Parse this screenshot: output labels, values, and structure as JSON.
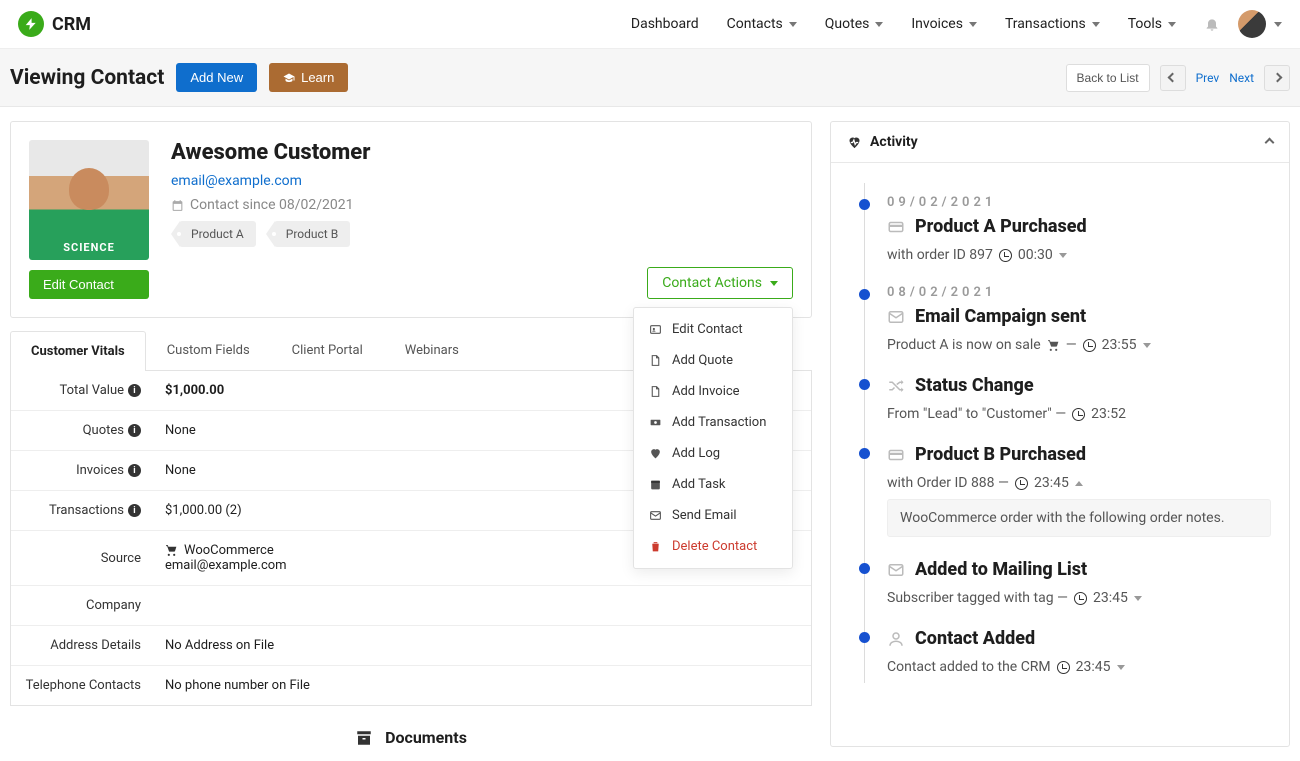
{
  "brand": "CRM",
  "nav": {
    "dashboard": "Dashboard",
    "contacts": "Contacts",
    "quotes": "Quotes",
    "invoices": "Invoices",
    "transactions": "Transactions",
    "tools": "Tools"
  },
  "subheader": {
    "title": "Viewing Contact",
    "add_new": "Add New",
    "learn": "Learn",
    "back": "Back to List",
    "prev": "Prev",
    "next": "Next"
  },
  "contact": {
    "name": "Awesome Customer",
    "email": "email@example.com",
    "since": "Contact since 08/02/2021",
    "tags": [
      "Product A",
      "Product B"
    ],
    "edit": "Edit Contact",
    "shirt": "SCIENCE"
  },
  "actions": {
    "button": "Contact Actions",
    "items": [
      {
        "icon": "id",
        "label": "Edit Contact"
      },
      {
        "icon": "file",
        "label": "Add Quote"
      },
      {
        "icon": "file",
        "label": "Add Invoice"
      },
      {
        "icon": "cash",
        "label": "Add Transaction"
      },
      {
        "icon": "heart",
        "label": "Add Log"
      },
      {
        "icon": "cal",
        "label": "Add Task"
      },
      {
        "icon": "mail",
        "label": "Send Email"
      },
      {
        "icon": "trash",
        "label": "Delete Contact",
        "danger": true
      }
    ]
  },
  "tabs": {
    "vitals": "Customer Vitals",
    "custom": "Custom Fields",
    "portal": "Client Portal",
    "webinars": "Webinars"
  },
  "vitals": {
    "total_value_l": "Total Value",
    "total_value_v": "$1,000.00",
    "quotes_l": "Quotes",
    "quotes_v": "None",
    "invoices_l": "Invoices",
    "invoices_v": "None",
    "transactions_l": "Transactions",
    "transactions_v": "$1,000.00 (2)",
    "source_l": "Source",
    "source_v1": "WooCommerce",
    "source_v2": "email@example.com",
    "company_l": "Company",
    "company_v": "",
    "address_l": "Address Details",
    "address_v": "No Address on File",
    "phone_l": "Telephone Contacts",
    "phone_v": "No phone number on File"
  },
  "documents": {
    "title": "Documents"
  },
  "activity": {
    "title": "Activity",
    "items": [
      {
        "dot": true,
        "date": "09/02/2021",
        "icon": "card",
        "title": "Product A Purchased",
        "desc_pre": "with order ID 897",
        "time": "00:30",
        "caret": "down"
      },
      {
        "dot": true,
        "date": "08/02/2021",
        "icon": "mail",
        "title": "Email Campaign sent",
        "desc_pre": "Product A is now on sale",
        "cart": true,
        "dash": true,
        "time": "23:55",
        "caret": "down"
      },
      {
        "dot": true,
        "icon": "shuffle",
        "title": "Status Change",
        "desc_pre": "From \"Lead\" to \"Customer\" —",
        "time": "23:52"
      },
      {
        "dot": true,
        "icon": "card",
        "title": "Product B Purchased",
        "desc_pre": "with Order ID 888 —",
        "time": "23:45",
        "caret": "up",
        "note": "WooCommerce order with the following order notes."
      },
      {
        "dot": true,
        "icon": "mail",
        "title": "Added to Mailing List",
        "desc_pre": "Subscriber tagged with tag —",
        "time": "23:45",
        "caret": "down"
      },
      {
        "dot": true,
        "icon": "user",
        "title": "Contact Added",
        "desc_pre": "Contact added to the CRM",
        "time": "23:45",
        "caret": "down"
      }
    ]
  }
}
